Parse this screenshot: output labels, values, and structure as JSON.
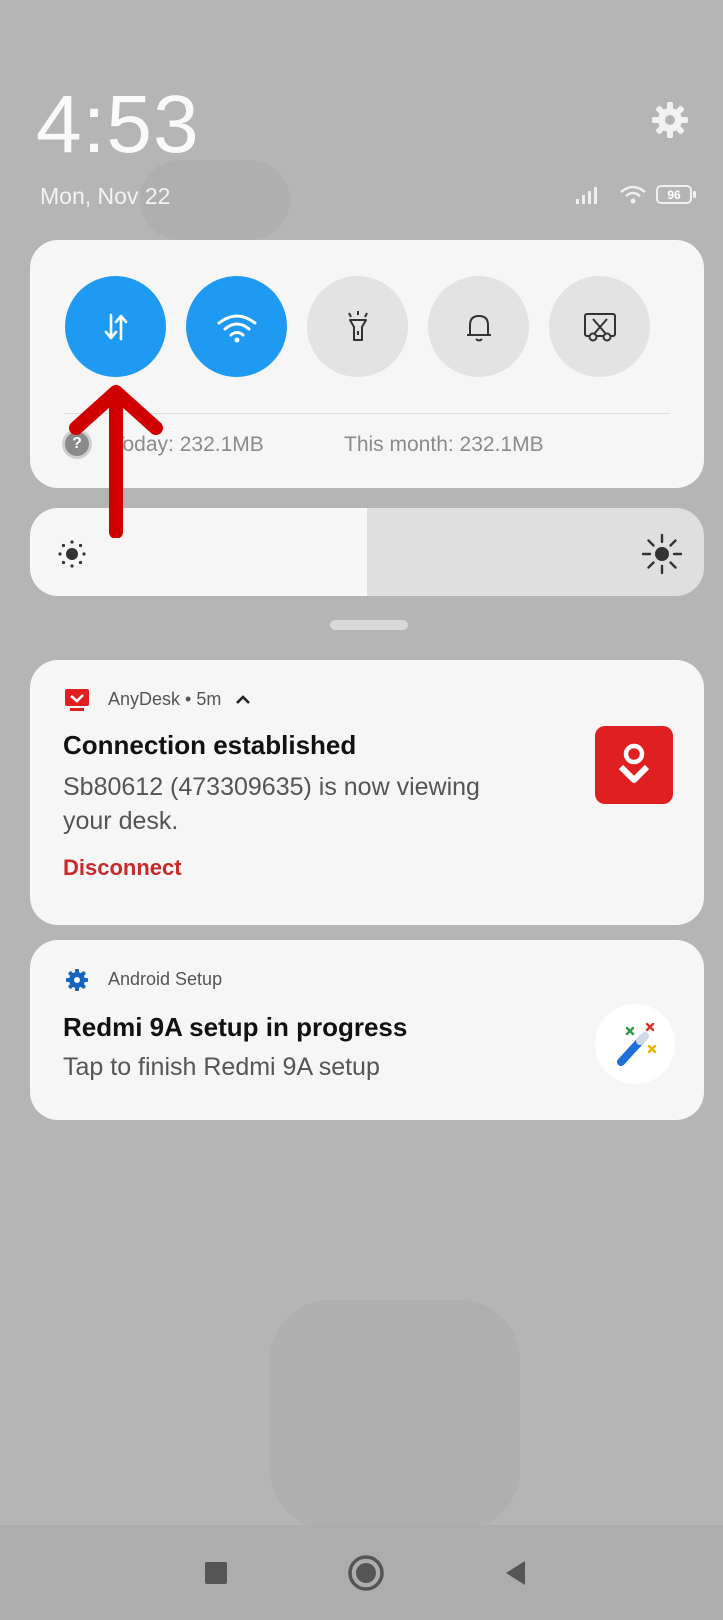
{
  "lock": {
    "time": "4:53",
    "date": "Mon, Nov 22",
    "battery": "96"
  },
  "quick_settings": {
    "tiles": [
      {
        "name": "mobile-data",
        "icon": "data-arrows-icon",
        "state": "on"
      },
      {
        "name": "wifi",
        "icon": "wifi-icon",
        "state": "on"
      },
      {
        "name": "flashlight",
        "icon": "flashlight-icon",
        "state": "off"
      },
      {
        "name": "sound",
        "icon": "bell-icon",
        "state": "off"
      },
      {
        "name": "screenshot",
        "icon": "scissors-icon",
        "state": "off"
      }
    ],
    "usage_today": "Today: 232.1MB",
    "usage_month": "This month: 232.1MB"
  },
  "brightness": {
    "level": 0.5
  },
  "notifications": [
    {
      "app": "AnyDesk",
      "meta": "AnyDesk • 5m",
      "title": "Connection established",
      "body": "Sb80612 (473309635) is now viewing your desk.",
      "action": "Disconnect",
      "accent": "#c92a2a"
    },
    {
      "app": "Android Setup",
      "meta": "Android Setup",
      "title": "Redmi 9A setup in progress",
      "body": "Tap to finish Redmi 9A setup",
      "accent": "#1565c0"
    }
  ],
  "colors": {
    "tile_on": "#1f9af3",
    "tile_off": "#e3e3e3",
    "annotation_arrow": "#d00000"
  }
}
